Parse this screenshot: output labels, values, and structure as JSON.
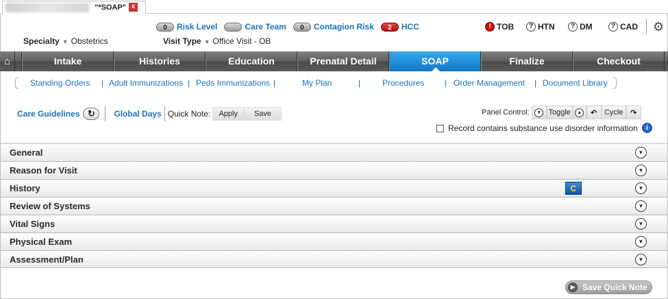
{
  "window": {
    "tab_title": "\"*SOAP\"",
    "close_glyph": "x"
  },
  "header": {
    "flags": [
      {
        "count": "0",
        "label": "Risk Level",
        "style": "gray"
      },
      {
        "count": "",
        "label": "Care Team",
        "style": "gray"
      },
      {
        "count": "0",
        "label": "Contagion Risk",
        "style": "gray"
      },
      {
        "count": "2",
        "label": "HCC",
        "style": "red"
      }
    ],
    "conditions": [
      {
        "label": "TOB",
        "icon": "alert-red"
      },
      {
        "label": "HTN",
        "icon": "question"
      },
      {
        "label": "DM",
        "icon": "question"
      },
      {
        "label": "CAD",
        "icon": "question"
      }
    ],
    "specialty_label": "Specialty",
    "specialty_value": "Obstetrics",
    "visit_type_label": "Visit Type",
    "visit_type_value": "Office Visit - OB"
  },
  "nav": {
    "tabs": [
      "Intake",
      "Histories",
      "Education",
      "Prenatal Detail",
      "SOAP",
      "Finalize",
      "Checkout"
    ],
    "active": "SOAP"
  },
  "subnav": [
    "Standing Orders",
    "Adult Immunizations",
    "Peds Immunizations",
    "My Plan",
    "Procedures",
    "Order Management",
    "Document Library"
  ],
  "tools": {
    "care_guidelines": "Care Guidelines",
    "global_days": "Global Days",
    "quick_note_label": "Quick Note:",
    "apply": "Apply",
    "save": "Save",
    "panel_control_label": "Panel Control:",
    "toggle": "Toggle",
    "cycle": "Cycle",
    "substance_text": "Record contains substance use disorder information"
  },
  "sections": [
    "General",
    "Reason for Visit",
    "History",
    "Review of Systems",
    "Vital Signs",
    "Physical Exam",
    "Assessment/Plan"
  ],
  "footer": {
    "save_quick_note": "Save Quick Note"
  }
}
